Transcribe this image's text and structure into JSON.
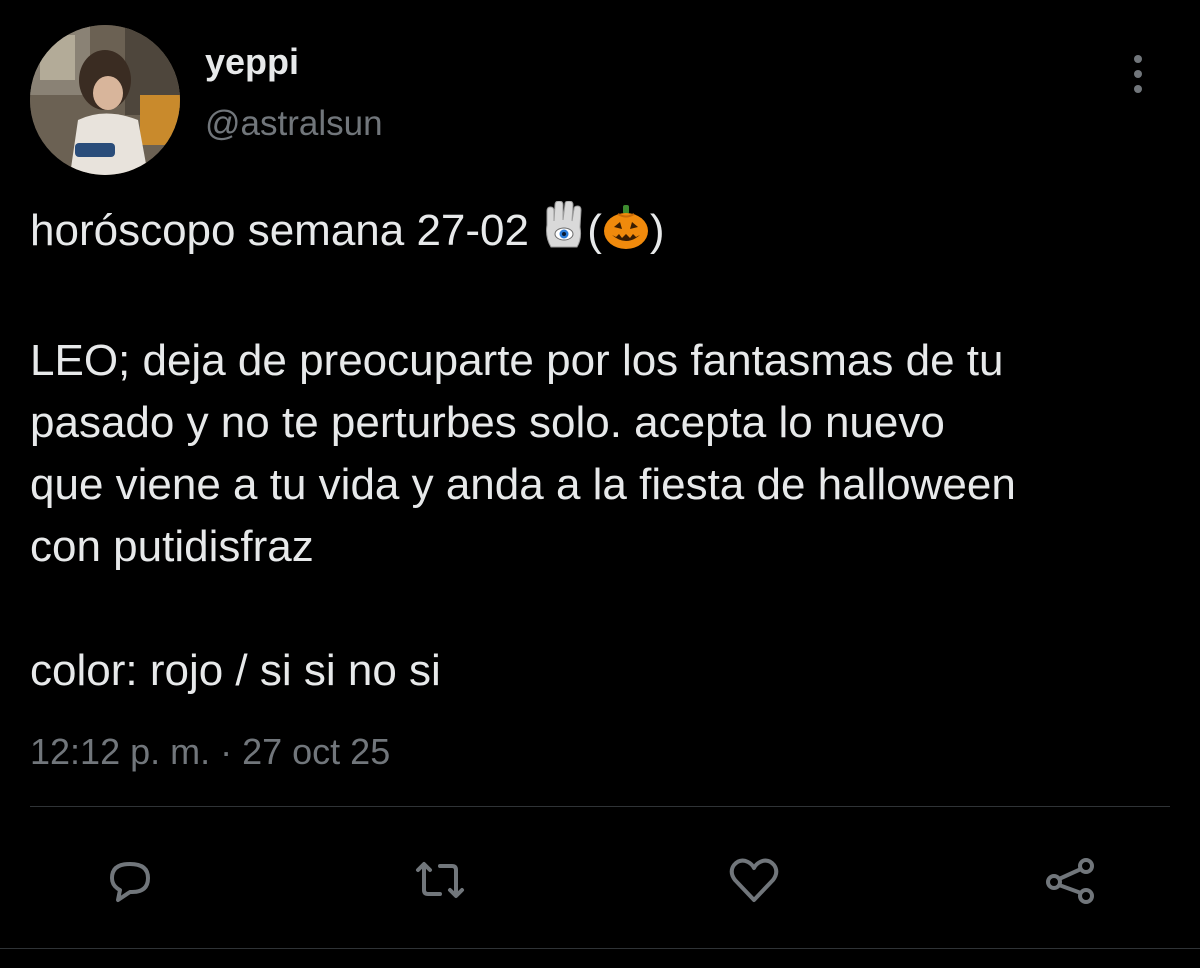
{
  "user": {
    "display_name": "yeppi",
    "handle": "@astralsun"
  },
  "tweet": {
    "line1": "horóscopo semana 27-02 ",
    "paren_open": "(",
    "paren_close": ")",
    "paragraph2": "LEO; deja de preocuparte por los fantasmas de tu\npasado y no te perturbes solo. acepta lo nuevo\nque viene a tu vida y anda a la fiesta de halloween\ncon putidisfraz",
    "paragraph3": "color: rojo / si si no si",
    "emojis": [
      "hamsa-emoji",
      "jack-o-lantern-emoji"
    ],
    "timestamp": "12:12 p. m. · 27 oct 25"
  },
  "actions": [
    "reply-icon",
    "retweet-icon",
    "like-icon",
    "share-icon"
  ],
  "colors": {
    "background": "#000000",
    "text": "#e7e9ea",
    "secondary": "#71767b",
    "divider": "#2f3336"
  }
}
